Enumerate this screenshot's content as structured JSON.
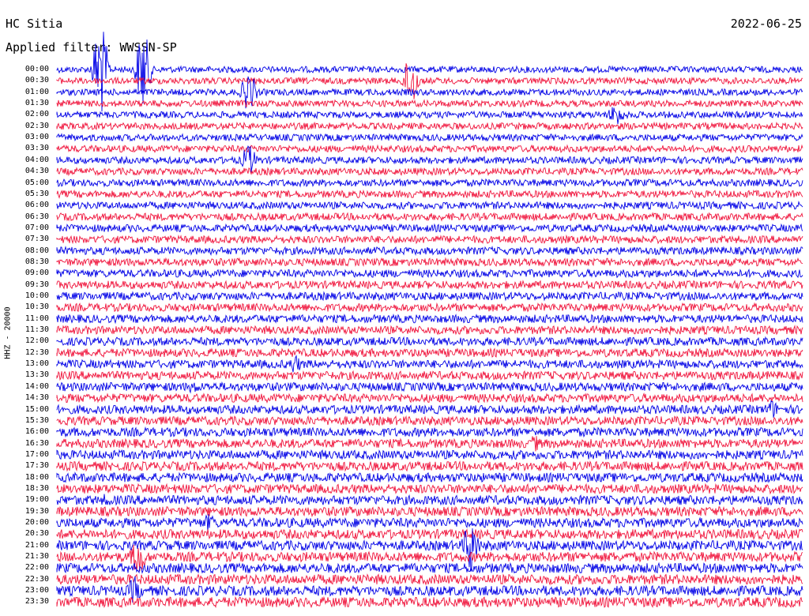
{
  "header": {
    "station": "HC Sitia",
    "date": "2022-06-25",
    "filter": "Applied filter: WWSSN-SP"
  },
  "axis": {
    "channel_label": "HHZ - 20000"
  },
  "time_labels": [
    "00:00",
    "00:30",
    "01:00",
    "01:30",
    "02:00",
    "02:30",
    "03:00",
    "03:30",
    "04:00",
    "04:30",
    "05:00",
    "05:30",
    "06:00",
    "06:30",
    "07:00",
    "07:30",
    "08:00",
    "08:30",
    "09:00",
    "09:30",
    "10:00",
    "10:30",
    "11:00",
    "11:30",
    "12:00",
    "12:30",
    "13:00",
    "13:30",
    "14:00",
    "14:30",
    "15:00",
    "15:30",
    "16:00",
    "16:30",
    "17:00",
    "17:30",
    "18:00",
    "18:30",
    "19:00",
    "19:30",
    "20:00",
    "20:30",
    "21:00",
    "21:30",
    "22:00",
    "22:30",
    "23:00",
    "23:30"
  ],
  "colors": {
    "trace_a": "#0000e6",
    "trace_b": "#f0143c"
  }
}
